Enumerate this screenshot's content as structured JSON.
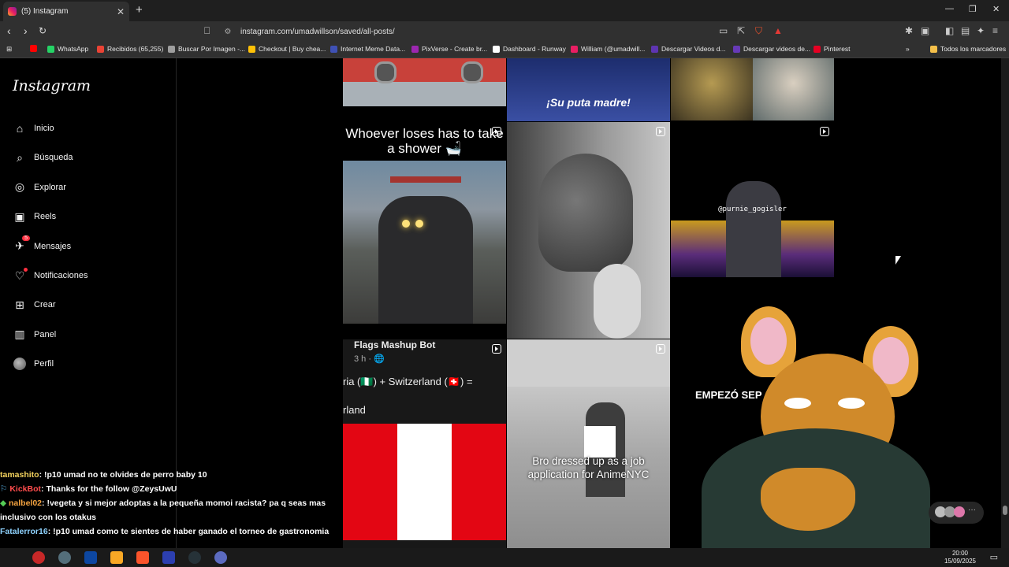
{
  "browser": {
    "tab_title": "(5) Instagram",
    "url": "instagram.com/umadwillson/saved/all-posts/",
    "bookmarks": [
      {
        "label": "",
        "color": "#ff0000"
      },
      {
        "label": "WhatsApp",
        "color": "#25d366"
      },
      {
        "label": "Recibidos (65,255)",
        "color": "#ea4335"
      },
      {
        "label": "Buscar Por Imagen -...",
        "color": "#9e9e9e"
      },
      {
        "label": "Checkout | Buy chea...",
        "color": "#ffc107"
      },
      {
        "label": "Internet Meme Data...",
        "color": "#3f51b5"
      },
      {
        "label": "PixVerse - Create br...",
        "color": "#9c27b0"
      },
      {
        "label": "Dashboard - Runway",
        "color": "#ffffff"
      },
      {
        "label": "William (@umadwill...",
        "color": "#e91e63"
      },
      {
        "label": "Descargar Videos d...",
        "color": "#5e35b1"
      },
      {
        "label": "Descargar videos de...",
        "color": "#673ab7"
      },
      {
        "label": "Pinterest",
        "color": "#e60023"
      }
    ],
    "all_bookmarks": "Todos los marcadores"
  },
  "instagram": {
    "logo": "Instagram",
    "nav": [
      {
        "label": "Inicio",
        "icon": "home-icon"
      },
      {
        "label": "Búsqueda",
        "icon": "search-icon"
      },
      {
        "label": "Explorar",
        "icon": "compass-icon"
      },
      {
        "label": "Reels",
        "icon": "reels-icon"
      },
      {
        "label": "Mensajes",
        "icon": "messenger-icon",
        "badge": "5"
      },
      {
        "label": "Notificaciones",
        "icon": "heart-icon"
      },
      {
        "label": "Crear",
        "icon": "plus-square-icon"
      },
      {
        "label": "Panel",
        "icon": "dashboard-icon"
      },
      {
        "label": "Perfil",
        "icon": "avatar"
      }
    ],
    "posts": {
      "p2_caption": "¡Su puta madre!",
      "p4_caption": "Whoever loses has to take a shower 🛁",
      "p6_watermark": "@purnie_gogisler",
      "p7_title": "Flags Mashup Bot",
      "p7_time": "3 h · 🌐",
      "p7_text": "ria (🇳🇬) + Switzerland (🇨🇭) =",
      "p7_text2": "rland",
      "p8_caption": "Bro dressed up as a job application for AnimeNYC",
      "p9_caption": "EMPEZÓ SEP"
    }
  },
  "chat": [
    {
      "user": "tamashito",
      "msg": ": !p10 umad no te olvides de perro baby 10"
    },
    {
      "user": "KickBot",
      "msg": ": Thanks for the follow @ZeysUwU"
    },
    {
      "user": "nalbel02",
      "msg": ": !vegeta y si mejor adoptas a la pequeña momoi racista? pa q seas mas inclusivo con los otakus"
    },
    {
      "user": "Fatalerror16",
      "msg": ": !p10 umad como te sientes de haber ganado el torneo de gastronomia"
    }
  ],
  "taskbar": {
    "time": "20:00",
    "date": "15/09/2025"
  }
}
